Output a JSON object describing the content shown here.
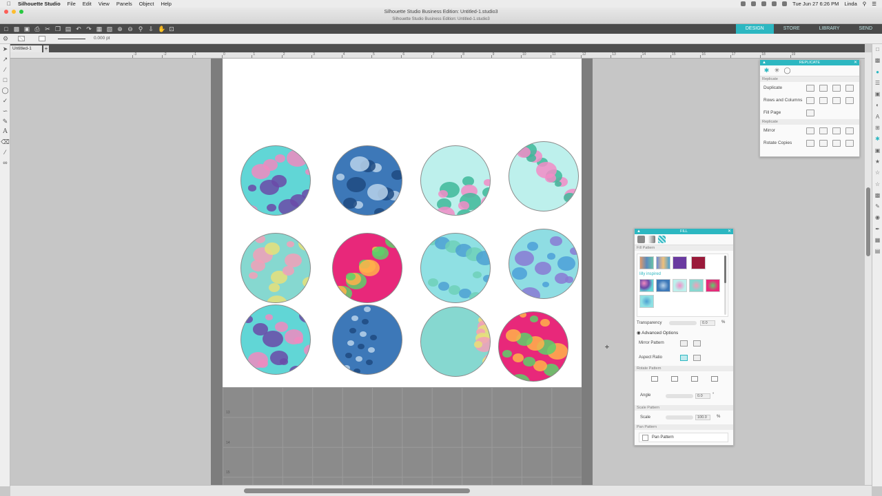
{
  "menubar": {
    "app_name": "Silhouette Studio",
    "menus": [
      "File",
      "Edit",
      "View",
      "Panels",
      "Object",
      "Help"
    ],
    "clock": "Tue Jun 27  6:26 PM",
    "user": "Linda"
  },
  "window": {
    "title": "Silhouette Studio Business Edition: Untitled-1.studio3",
    "subtitle": "Silhouette Studio Business Edition: Untitled-1.studio3"
  },
  "top_tabs": [
    {
      "label": "DESIGN",
      "active": true
    },
    {
      "label": "STORE",
      "active": false
    },
    {
      "label": "LIBRARY",
      "active": false
    },
    {
      "label": "SEND",
      "active": false
    }
  ],
  "toolbar2": {
    "line_value": "0.000 pt"
  },
  "doc_tab": {
    "label": "Untitled-1",
    "add_label": "+"
  },
  "ruler_numbers": [
    "-3",
    "-2",
    "-1",
    "0",
    "1",
    "2",
    "3",
    "4",
    "5",
    "6",
    "7",
    "8",
    "9",
    "10",
    "11",
    "12",
    "13",
    "14",
    "15",
    "16",
    "17",
    "18",
    "19"
  ],
  "mat_numbers": [
    "13",
    "14",
    "15"
  ],
  "replicate_panel": {
    "title": "REPLICATE",
    "section1": "Replicate",
    "rows1": [
      "Duplicate",
      "Rows and Columns",
      "Fill Page"
    ],
    "section2": "Replicate",
    "rows2": [
      "Mirror",
      "Rotate Copies"
    ]
  },
  "fill_panel": {
    "title": "FILL",
    "fill_pattern_label": "Fill Pattern",
    "group_label": "lilly inspired",
    "transparency_label": "Transparency",
    "transparency_value": "0.0",
    "transparency_unit": "%",
    "advanced_label": "Advanced Options",
    "mirror_label": "Mirror Pattern",
    "aspect_label": "Aspect Ratio",
    "rotate_section": "Rotate Pattern",
    "angle_label": "Angle",
    "angle_value": "0.0",
    "angle_unit": "°",
    "scale_section": "Scale Pattern",
    "scale_label": "Scale",
    "scale_value": "100.0",
    "scale_unit": "%",
    "pan_section": "Pan Pattern",
    "pan_label": "Pan Pattern"
  },
  "colors": {
    "accent": "#2cb7c1",
    "toolbar": "#4a4a4a",
    "mat": "#7d7d7d"
  },
  "circles": [
    {
      "name": "paisley",
      "bg": "#61d6d6",
      "c1": "#6b4aa8",
      "c2": "#f08ac0"
    },
    {
      "name": "blue-ikat",
      "bg": "#3d78b8",
      "c1": "#1f4a80",
      "c2": "#b8d2ea"
    },
    {
      "name": "pink-lobster",
      "bg": "#bdf0ec",
      "c1": "#f28cc7",
      "c2": "#3fb89a"
    },
    {
      "name": "pink-lobster-2",
      "bg": "#bdf0ec",
      "c1": "#f28cc7",
      "c2": "#3fb89a"
    },
    {
      "name": "sailboats",
      "bg": "#86d8d0",
      "c1": "#e6e07a",
      "c2": "#f2a0b8"
    },
    {
      "name": "tropical-pink",
      "bg": "#e8287a",
      "c1": "#5dd06a",
      "c2": "#ffb14a"
    },
    {
      "name": "roses-teal",
      "bg": "#8fe0e3",
      "c1": "#4da0d2",
      "c2": "#6ed0b8"
    },
    {
      "name": "roses-purple",
      "bg": "#8fdde3",
      "c1": "#8a7ad4",
      "c2": "#4ca0d8"
    },
    {
      "name": "paisley-2",
      "bg": "#61d6d6",
      "c1": "#6b4aa8",
      "c2": "#f08ac0"
    },
    {
      "name": "blue-ikat-2",
      "bg": "#3d78b8",
      "c1": "#1f4a80",
      "c2": "#b8d2ea"
    },
    {
      "name": "sailboats-2",
      "bg": "#86d8d0",
      "c1": "#e6e07a",
      "c2": "#f2a0b8"
    },
    {
      "name": "tropical-pink-2",
      "bg": "#e8287a",
      "c1": "#5dd06a",
      "c2": "#ffb14a"
    }
  ]
}
